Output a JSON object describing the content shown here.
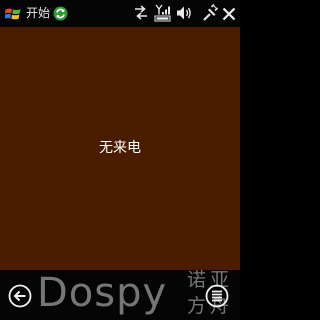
{
  "status_bar": {
    "start_label": "开始",
    "icons": {
      "start": "windows-flag-icon",
      "sync": "sync-icon",
      "data": "data-arrows-icon",
      "signal": "signal-icon",
      "volume": "volume-icon",
      "connectivity": "connectivity-icon",
      "close": "close-icon"
    }
  },
  "content": {
    "message": "无来电",
    "background_color": "#4a1d00"
  },
  "softkey_bar": {
    "back_icon": "back-arrow-icon",
    "menu_icon": "menu-icon"
  },
  "watermark": {
    "brand": "Dospy",
    "cn_line1": "诺亚",
    "cn_line2": "方舟"
  }
}
